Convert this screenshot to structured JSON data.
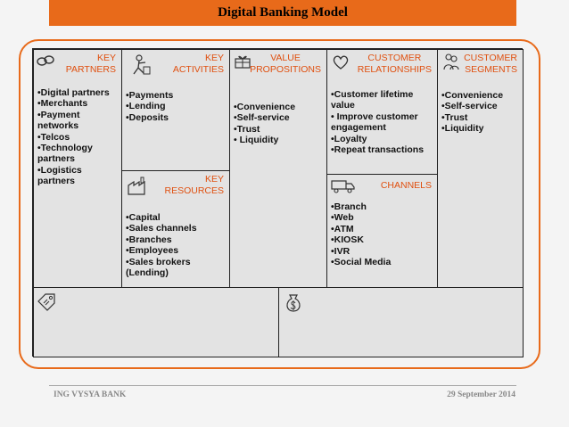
{
  "title": "Digital Banking Model",
  "footer": {
    "left": "ING VYSYA BANK",
    "right": "29 September 2014"
  },
  "blocks": {
    "key_partners": {
      "label": [
        "KEY",
        "PARTNERS"
      ],
      "icon": "chain-link-icon",
      "items": [
        "•Digital partners",
        "•Merchants",
        "•Payment networks",
        "•Telcos",
        "•Technology partners",
        "•Logistics partners"
      ]
    },
    "key_activities": {
      "label": [
        "KEY",
        "ACTIVITIES"
      ],
      "icon": "person-working-icon",
      "items": [
        "•Payments",
        "•Lending",
        "•Deposits"
      ]
    },
    "key_resources": {
      "label": [
        "KEY",
        "RESOURCES"
      ],
      "icon": "factory-icon",
      "items": [
        "•Capital",
        "•Sales channels",
        "•Branches",
        "•Employees",
        "•Sales brokers (Lending)"
      ]
    },
    "value_propositions": {
      "label": [
        "VALUE",
        "PROPOSITIONS"
      ],
      "icon": "gift-icon",
      "items": [
        "•Convenience",
        "•Self-service",
        "•Trust",
        "• Liquidity"
      ]
    },
    "customer_relationships": {
      "label": [
        "CUSTOMER",
        "RELATIONSHIPS"
      ],
      "icon": "heart-icon",
      "items": [
        "•Customer lifetime value",
        "• Improve customer engagement",
        "•Loyalty",
        "•Repeat transactions"
      ]
    },
    "channels": {
      "label": [
        "CHANNELS"
      ],
      "icon": "delivery-truck-icon",
      "items": [
        "•Branch",
        "•Web",
        "•ATM",
        "•KIOSK",
        "•IVR",
        "•Social Media"
      ]
    },
    "customer_segments": {
      "label": [
        "CUSTOMER",
        "SEGMENTS"
      ],
      "icon": "people-icon",
      "items": [
        "•Convenience",
        "•Self-service",
        "•Trust",
        "•Liquidity"
      ]
    },
    "cost_structure": {
      "icon": "price-tag-icon"
    },
    "revenue_streams": {
      "icon": "money-bag-icon"
    }
  }
}
